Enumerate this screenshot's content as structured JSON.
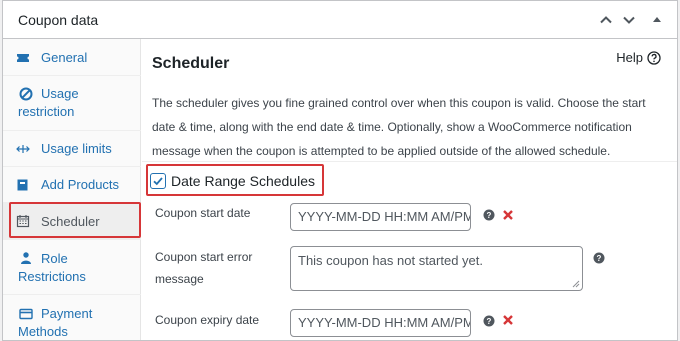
{
  "panel": {
    "title": "Coupon data",
    "controls": [
      "chevron-up-icon",
      "chevron-down-icon",
      "caret-up-icon"
    ]
  },
  "sidebar": {
    "items": [
      {
        "label": "General",
        "icon": "ticket-icon"
      },
      {
        "label": "Usage restriction",
        "icon": "prohibited-icon"
      },
      {
        "label": "Usage limits",
        "icon": "arrows-horizontal-icon"
      },
      {
        "label": "Add Products",
        "icon": "cart-icon"
      },
      {
        "label": "Scheduler",
        "icon": "calendar-icon",
        "active": true
      },
      {
        "label": "Role Restrictions",
        "icon": "person-icon"
      },
      {
        "label": "Payment Methods",
        "icon": "card-icon"
      }
    ]
  },
  "main": {
    "title": "Scheduler",
    "help_label": "Help",
    "description": "The scheduler gives you fine grained control over when this coupon is valid. Choose the start date & time, along with the end date & time. Optionally, show a WooCommerce notification message when the coupon is attempted to be applied outside of the allowed schedule.",
    "toggle": {
      "label": "Date Range Schedules",
      "checked": true
    },
    "fields": {
      "start_date": {
        "label": "Coupon start date",
        "placeholder": "YYYY-MM-DD HH:MM AM/PM",
        "value": ""
      },
      "start_error": {
        "label": "Coupon start error message",
        "value": "This coupon has not started yet."
      },
      "expiry_date": {
        "label": "Coupon expiry date",
        "placeholder": "YYYY-MM-DD HH:MM AM/PM",
        "value": ""
      }
    }
  },
  "colors": {
    "accent": "#2271b1",
    "highlight": "#d63638",
    "clear_x": "#d63638",
    "help_tip": "#50575e"
  }
}
